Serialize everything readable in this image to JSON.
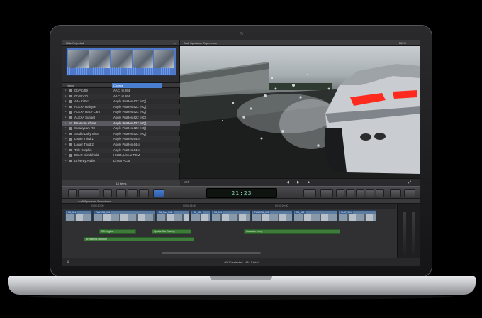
{
  "browser": {
    "header_label": "Hide Rejected",
    "columns": [
      "Name",
      "Codecs"
    ],
    "items": [
      {
        "name": "GoPro 09",
        "codec": "AAC, H.264"
      },
      {
        "name": "GoPro 10",
        "codec": "AAC, H.264"
      },
      {
        "name": "AJA Ki Pro",
        "codec": "Apple ProRes 422 (HQ)"
      },
      {
        "name": "ALEXA Halcyon",
        "codec": "Apple ProRes 422 (HQ)"
      },
      {
        "name": "ALEXA Race Cam",
        "codec": "Apple ProRes 422 (HQ)"
      },
      {
        "name": "ALEXA Sunset",
        "codec": "Apple ProRes 422 (HQ)"
      },
      {
        "name": "Phantom Above",
        "codec": "Apple ProRes 422 (HQ)",
        "selected": true
      },
      {
        "name": "Steadycam R8",
        "codec": "Apple ProRes 422 (HQ)"
      },
      {
        "name": "Studio Dolly Shot",
        "codec": "Apple ProRes 422 (HQ)"
      },
      {
        "name": "Lower Third 1",
        "codec": "Apple ProRes 4444"
      },
      {
        "name": "Lower Third 2",
        "codec": "Apple ProRes 4444"
      },
      {
        "name": "Title Graphic",
        "codec": "Apple ProRes 4444"
      },
      {
        "name": "DSLR Windshield",
        "codec": "H.264, Linear PCM"
      },
      {
        "name": "Drive By Audio",
        "codec": "Linear PCM"
      }
    ],
    "footer": "14 items"
  },
  "viewer": {
    "title": "Audi Sportscar Experience",
    "zoom": "100%"
  },
  "toolbar": {
    "timecode": "21:23"
  },
  "timeline": {
    "project_name": "Audi Sportscar Experience",
    "ruler_marks": [
      "00:00:10:00",
      "00:00:15:00",
      "00:00:20:00"
    ],
    "clips": [
      "R8_001",
      "PANTOM_001",
      "R8_Pan_012",
      "R8_003",
      "R8_001",
      "PANTOM_002",
      "R8_004",
      "FLAT_004"
    ],
    "audio_clips": [
      "R8 Engine",
      "Sports Car Racing",
      "Cascade Long",
      "Breakbeat Medium"
    ]
  },
  "status": {
    "text": "00:10 selected - 48:11 total"
  },
  "colors": {
    "accent": "#4a7fd0",
    "clip": "#5c7ba0",
    "audio": "#3f7b3a",
    "taillight": "#ff2a1e"
  },
  "icons": [
    "search-icon",
    "disclosure-icon",
    "play-icon",
    "back-icon",
    "forward-icon",
    "fullscreen-icon",
    "gear-icon",
    "key-icon"
  ]
}
